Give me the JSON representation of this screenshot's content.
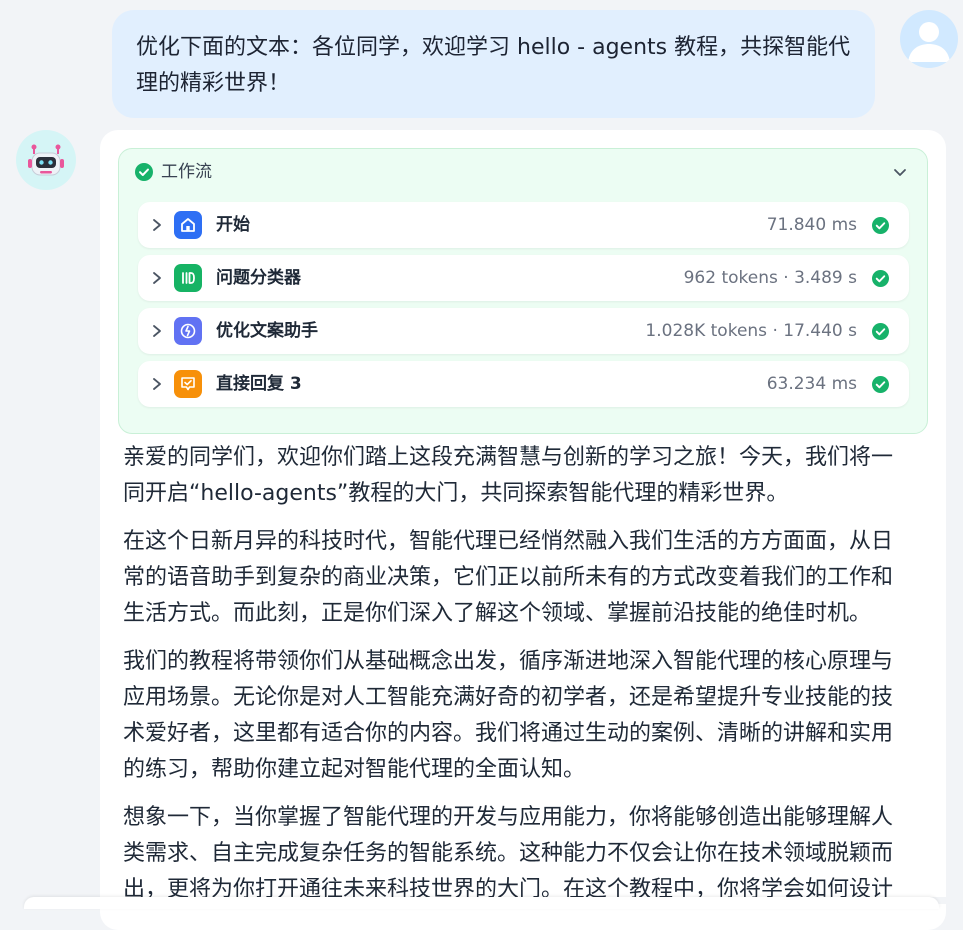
{
  "user_message": "优化下面的文本：各位同学，欢迎学习 hello - agents 教程，共探智能代理的精彩世界！",
  "workflow": {
    "title": "工作流",
    "nodes": [
      {
        "label": "开始",
        "meta": "71.840 ms",
        "icon": "home-icon",
        "color": "#2e6ff4"
      },
      {
        "label": "问题分类器",
        "meta": "962 tokens · 3.489 s",
        "icon": "classifier-icon",
        "color": "#16b364"
      },
      {
        "label": "优化文案助手",
        "meta": "1.028K tokens · 17.440 s",
        "icon": "llm-icon",
        "color": "#6172f3"
      },
      {
        "label": "直接回复 3",
        "meta": "63.234 ms",
        "icon": "answer-icon",
        "color": "#f79009"
      }
    ]
  },
  "answer": {
    "paragraphs": [
      "亲爱的同学们，欢迎你们踏上这段充满智慧与创新的学习之旅！今天，我们将一同开启“hello-agents”教程的大门，共同探索智能代理的精彩世界。",
      "在这个日新月异的科技时代，智能代理已经悄然融入我们生活的方方面面，从日常的语音助手到复杂的商业决策，它们正以前所未有的方式改变着我们的工作和生活方式。而此刻，正是你们深入了解这个领域、掌握前沿技能的绝佳时机。",
      "我们的教程将带领你们从基础概念出发，循序渐进地深入智能代理的核心原理与应用场景。无论你是对人工智能充满好奇的初学者，还是希望提升专业技能的技术爱好者，这里都有适合你的内容。我们将通过生动的案例、清晰的讲解和实用的练习，帮助你建立起对智能代理的全面认知。",
      "想象一下，当你掌握了智能代理的开发与应用能力，你将能够创造出能够理解人类需求、自主完成复杂任务的智能系统。这种能力不仅会让你在技术领域脱颖而出，更将为你打开通往未来科技世界的大门。在这个教程中，你将学会如何设计"
    ]
  },
  "colors": {
    "user_bubble": "#e1effe",
    "workflow_bg": "#ecfdf3",
    "success": "#17b26a"
  }
}
